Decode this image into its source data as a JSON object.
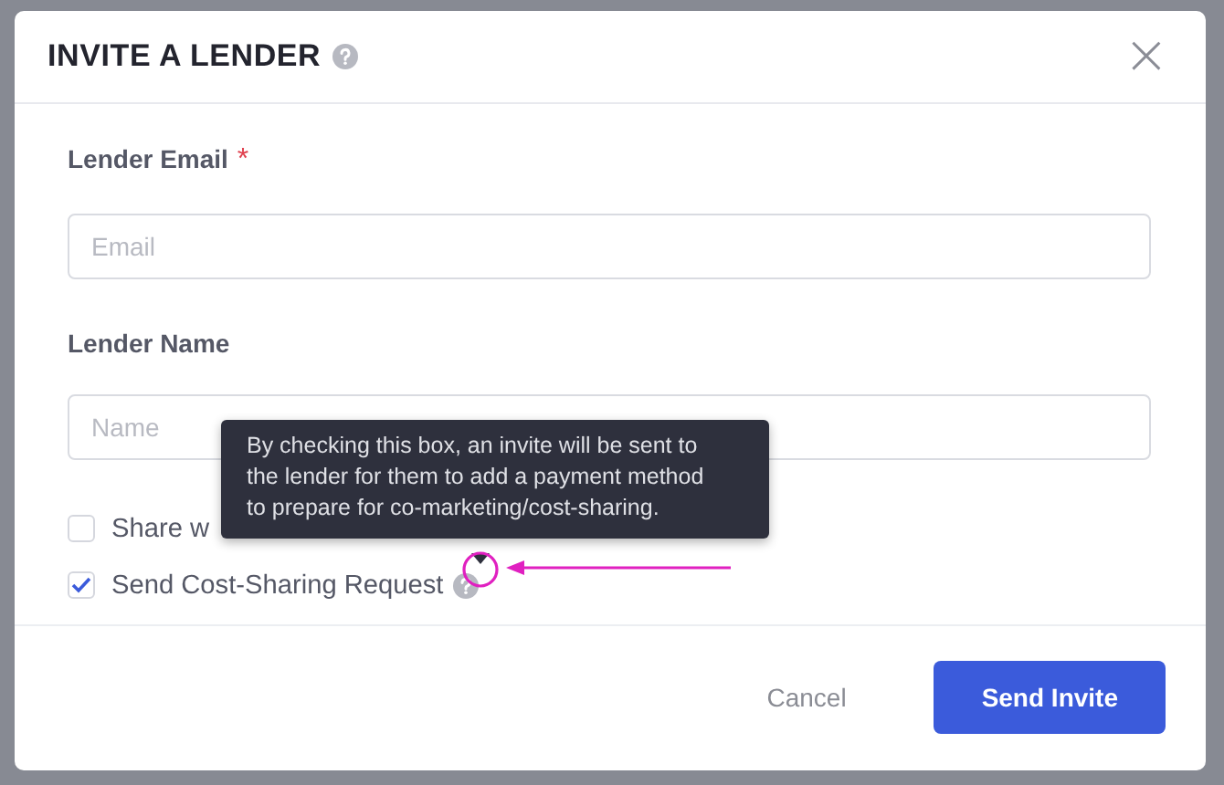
{
  "dialog": {
    "title": "INVITE A LENDER",
    "close": "×"
  },
  "fields": [
    {
      "label": "Lender Email",
      "required_mark": "*",
      "placeholder": "Email"
    },
    {
      "label": "Lender Name",
      "placeholder": "Name"
    }
  ],
  "checkboxes": [
    {
      "label": "Share w",
      "checked": false
    },
    {
      "label": "Send Cost-Sharing Request",
      "checked": true,
      "help": true
    }
  ],
  "tooltip": {
    "text": "By checking this box, an invite will be sent to the lender for them to add a payment method to prepare for co-marketing/cost-sharing."
  },
  "buttons": [
    {
      "label": "Cancel",
      "kind": "secondary"
    },
    {
      "label": "Send Invite",
      "kind": "primary"
    }
  ]
}
